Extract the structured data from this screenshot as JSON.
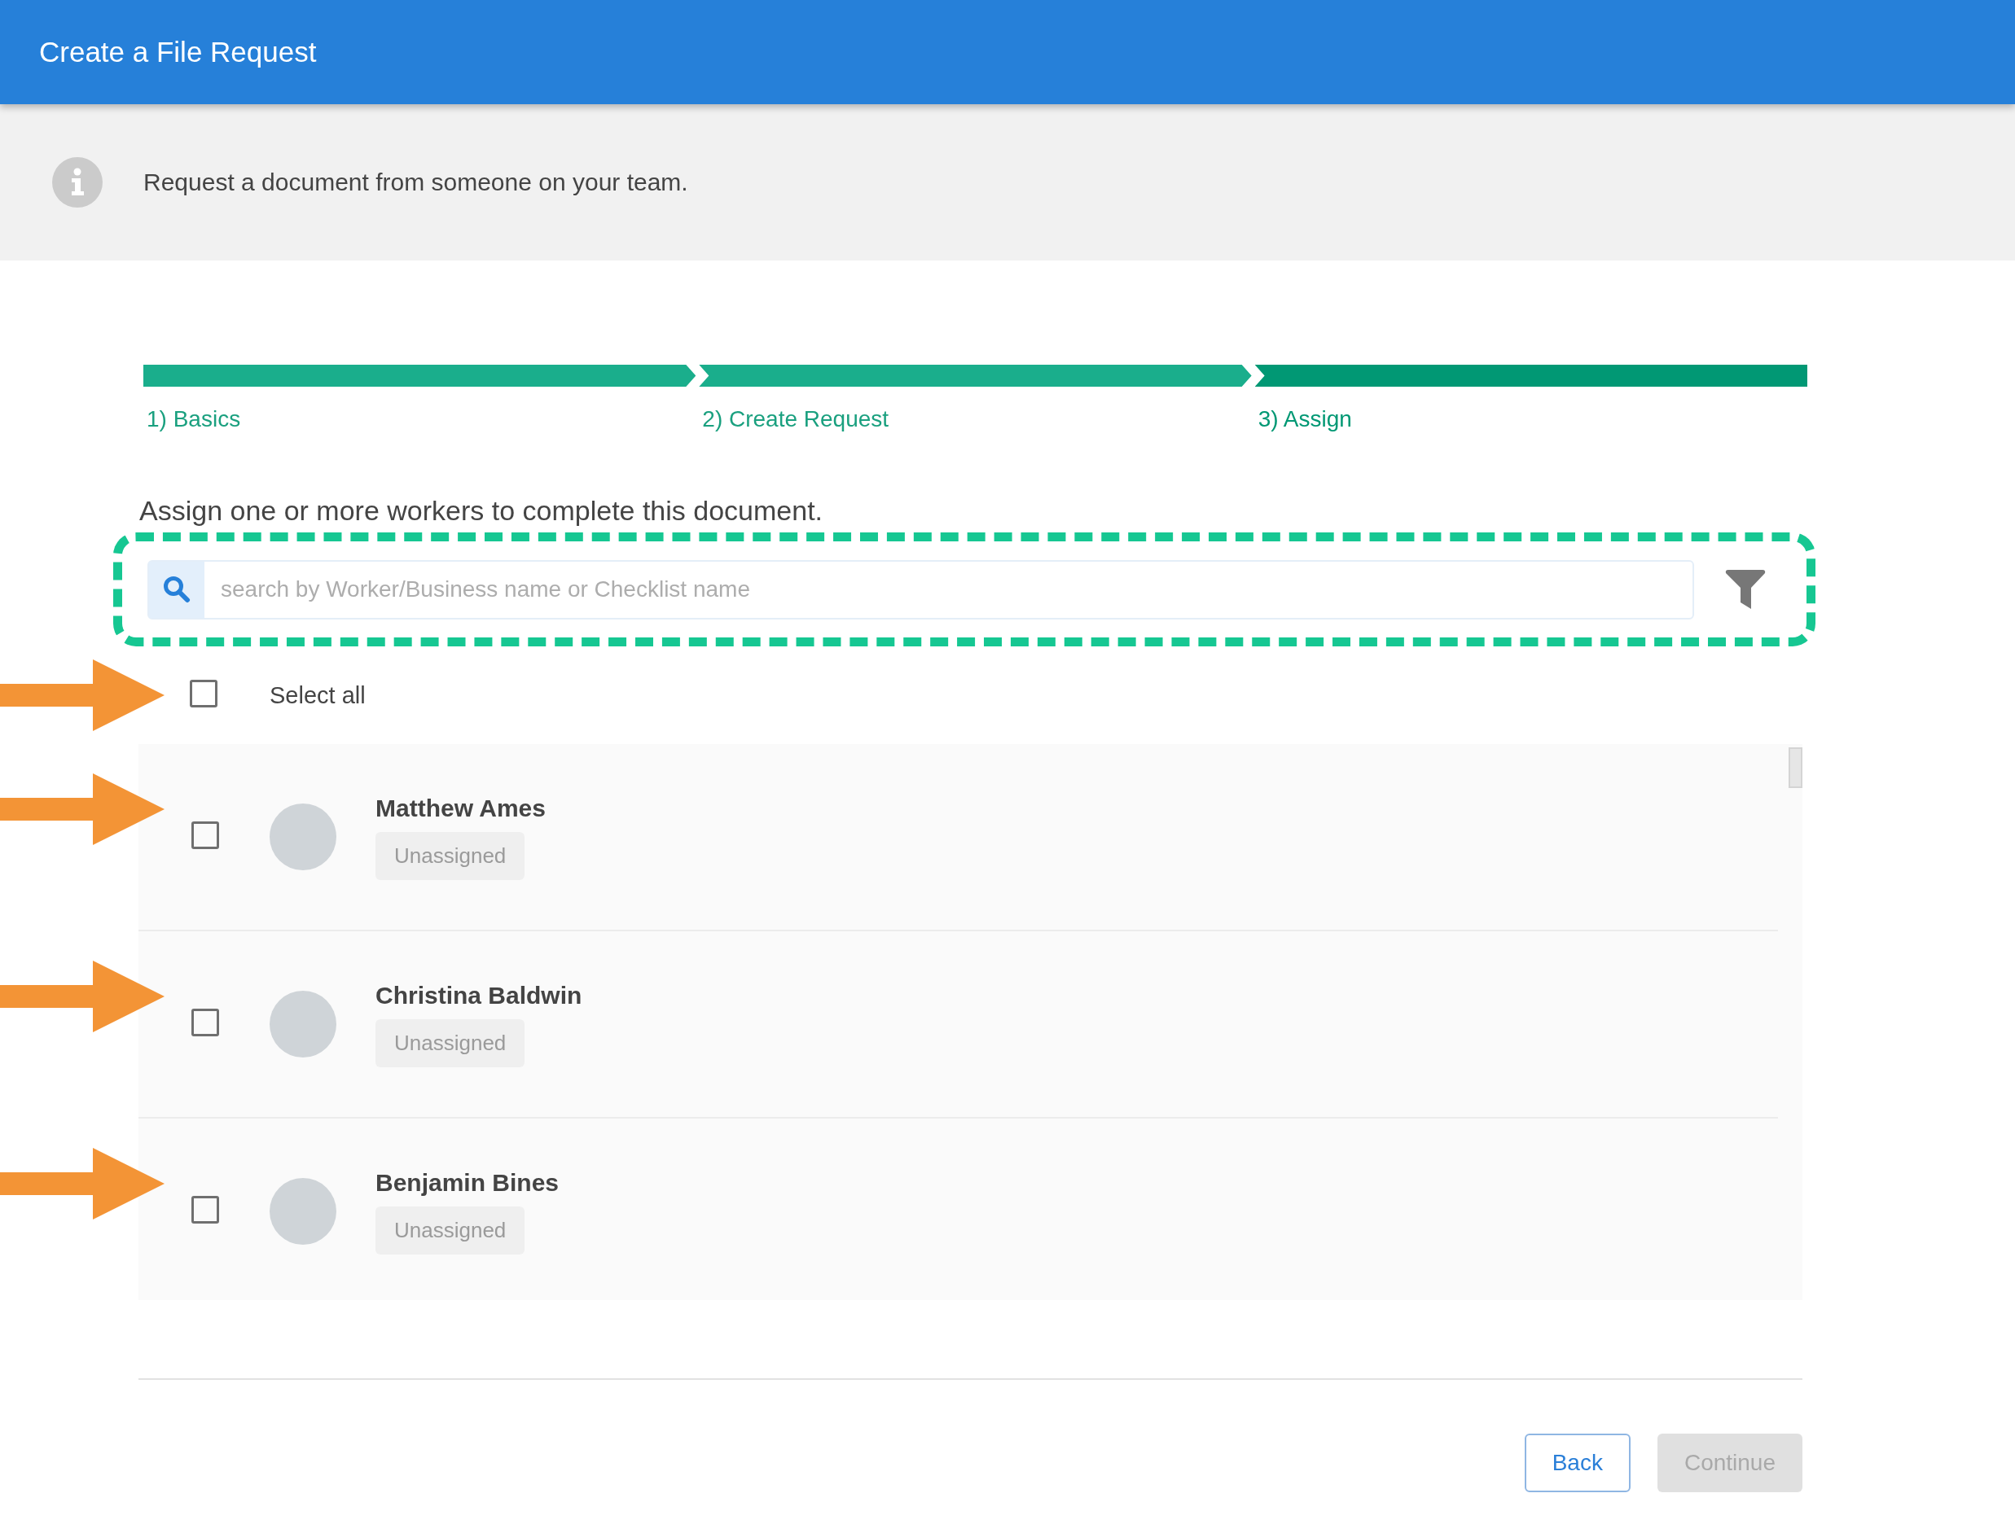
{
  "header": {
    "title": "Create a File Request"
  },
  "banner": {
    "text": "Request a document from someone on your team."
  },
  "steps": [
    {
      "label": "1) Basics",
      "selected": false
    },
    {
      "label": "2) Create Request",
      "selected": false
    },
    {
      "label": "3) Assign",
      "selected": true
    }
  ],
  "prompt": "Assign one or more workers to complete this document.",
  "search": {
    "placeholder": "search by Worker/Business name or Checklist name",
    "highlighted": true
  },
  "select_all": {
    "label": "Select all",
    "checked": false,
    "annotated": true
  },
  "workers": [
    {
      "name": "Matthew Ames",
      "status": "Unassigned",
      "checked": false,
      "annotated": true
    },
    {
      "name": "Christina Baldwin",
      "status": "Unassigned",
      "checked": false,
      "annotated": true
    },
    {
      "name": "Benjamin Bines",
      "status": "Unassigned",
      "checked": false,
      "annotated": true
    }
  ],
  "buttons": [
    {
      "label": "Back",
      "kind": "secondary",
      "disabled": false
    },
    {
      "label": "Continue",
      "kind": "primary",
      "disabled": true
    }
  ]
}
